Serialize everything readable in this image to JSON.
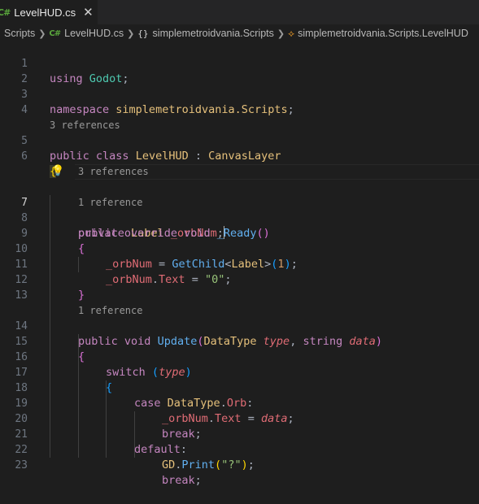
{
  "tab": {
    "icon": "C#",
    "title": "LevelHUD.cs",
    "close_glyph": "✕"
  },
  "breadcrumb": {
    "items": [
      "Scripts",
      "LevelHUD.cs",
      "simplemetroidvania.Scripts",
      "simplemetroidvania.Scripts.LevelHUD"
    ],
    "file_icon": "C#",
    "namespace_icon": "{}",
    "class_icon": "⟡"
  },
  "code": {
    "line_numbers": [
      "1",
      "2",
      "3",
      "4",
      "5",
      "6",
      "7",
      "8",
      "9",
      "10",
      "11",
      "12",
      "13",
      "14",
      "15",
      "16",
      "17",
      "18",
      "19",
      "20",
      "21",
      "22",
      "23"
    ],
    "lenses": [
      "3 references",
      "3 references",
      "1 reference",
      "1 reference"
    ],
    "l1": [
      "using",
      "Godot",
      ";"
    ],
    "l3": [
      "namespace",
      "simplemetroidvania.Scripts",
      ";"
    ],
    "l5": [
      "public",
      "class",
      "LevelHUD",
      ":",
      "CanvasLayer"
    ],
    "l6": [
      "{"
    ],
    "l7": [
      "private",
      "Label",
      "_orbNum",
      ";"
    ],
    "l8": [
      "public",
      "override",
      "void",
      "_Ready",
      "(",
      ")"
    ],
    "l9": [
      "{"
    ],
    "l10": [
      "_orbNum",
      "=",
      "GetChild",
      "<",
      "Label",
      ">",
      "(",
      "1",
      ")",
      ";"
    ],
    "l11": [
      "_orbNum",
      ".",
      "Text",
      "=",
      "\"0\"",
      ";"
    ],
    "l12": [
      "}"
    ],
    "l14": [
      "public",
      "void",
      "Update",
      "(",
      "DataType",
      "type",
      ",",
      "string",
      "data",
      ")"
    ],
    "l15": [
      "{"
    ],
    "l16": [
      "switch",
      "(",
      "type",
      ")"
    ],
    "l17": [
      "{"
    ],
    "l18": [
      "case",
      "DataType",
      ".",
      "Orb",
      ":"
    ],
    "l19": [
      "_orbNum",
      ".",
      "Text",
      "=",
      "data",
      ";"
    ],
    "l20": [
      "break",
      ";"
    ],
    "l21": [
      "default",
      ":"
    ],
    "l22": [
      "GD",
      ".",
      "Print",
      "(",
      "\"?\"",
      ")",
      ";"
    ],
    "l23": [
      "break",
      ";"
    ]
  },
  "colors": {
    "background": "#1e1e1e",
    "keyword": "#c586c0",
    "type": "#e5c07b",
    "method": "#61afef",
    "string": "#98c379",
    "field": "#e06c75"
  }
}
